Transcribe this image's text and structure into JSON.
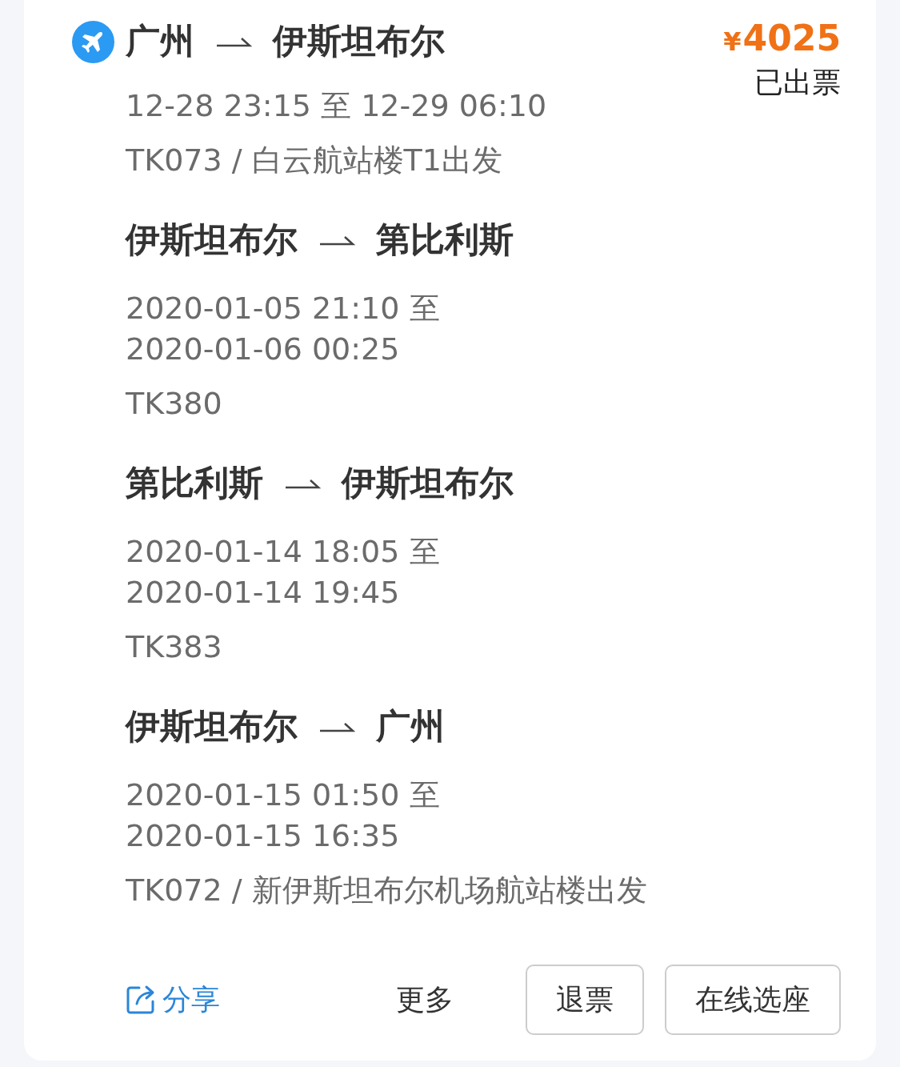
{
  "order": {
    "price_symbol": "¥",
    "price": "4025",
    "status": "已出票"
  },
  "segments": [
    {
      "from": "广州",
      "to": "伊斯坦布尔",
      "times": [
        "12-28 23:15 至 12-29 06:10"
      ],
      "flight": "TK073 / 白云航站楼T1出发"
    },
    {
      "from": "伊斯坦布尔",
      "to": "第比利斯",
      "times": [
        "2020-01-05 21:10 至",
        "2020-01-06 00:25"
      ],
      "flight": "TK380"
    },
    {
      "from": "第比利斯",
      "to": "伊斯坦布尔",
      "times": [
        "2020-01-14 18:05 至",
        "2020-01-14 19:45"
      ],
      "flight": "TK383"
    },
    {
      "from": "伊斯坦布尔",
      "to": "广州",
      "times": [
        "2020-01-15 01:50 至",
        "2020-01-15 16:35"
      ],
      "flight": "TK072 / 新伊斯坦布尔机场航站楼出发"
    }
  ],
  "actions": {
    "share": "分享",
    "more": "更多",
    "buttons": [
      "退票",
      "在线选座"
    ]
  }
}
